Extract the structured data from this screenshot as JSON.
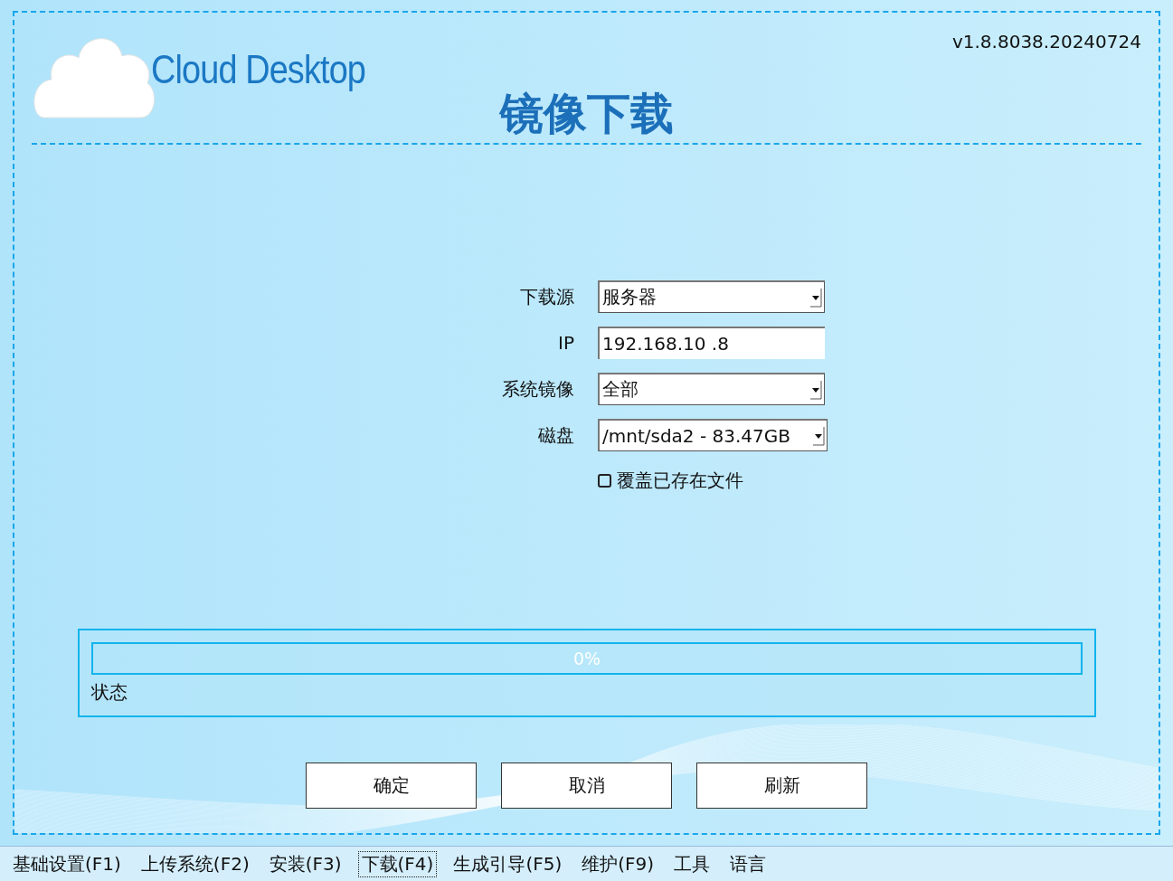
{
  "header": {
    "logo_text": "Cloud Desktop",
    "version": "v1.8.8038.20240724",
    "title": "镜像下载"
  },
  "form": {
    "fields": [
      {
        "label": "下载源",
        "kind": "dropdown",
        "value": "服务器"
      },
      {
        "label": "IP",
        "kind": "text",
        "value": "192.168.10 .8"
      },
      {
        "label": "系统镜像",
        "kind": "dropdown",
        "value": "全部"
      },
      {
        "label": "磁盘",
        "kind": "dropdown",
        "value": "/mnt/sda2 - 83.47GB"
      }
    ],
    "checkbox": {
      "label": "覆盖已存在文件",
      "checked": false
    }
  },
  "progress": {
    "level": 0,
    "reading": "0%",
    "status_label": "状态"
  },
  "buttons": [
    "确定",
    "取消",
    "刷新"
  ],
  "menu": [
    {
      "label": "基础设置(F1)",
      "selected": false
    },
    {
      "label": "上传系统(F2)",
      "selected": false
    },
    {
      "label": "安装(F3)",
      "selected": false
    },
    {
      "label": "下载(F4)",
      "selected": true
    },
    {
      "label": "生成引导(F5)",
      "selected": false
    },
    {
      "label": "维护(F9)",
      "selected": false
    },
    {
      "label": "工具",
      "selected": false
    },
    {
      "label": "语言",
      "selected": false
    }
  ]
}
